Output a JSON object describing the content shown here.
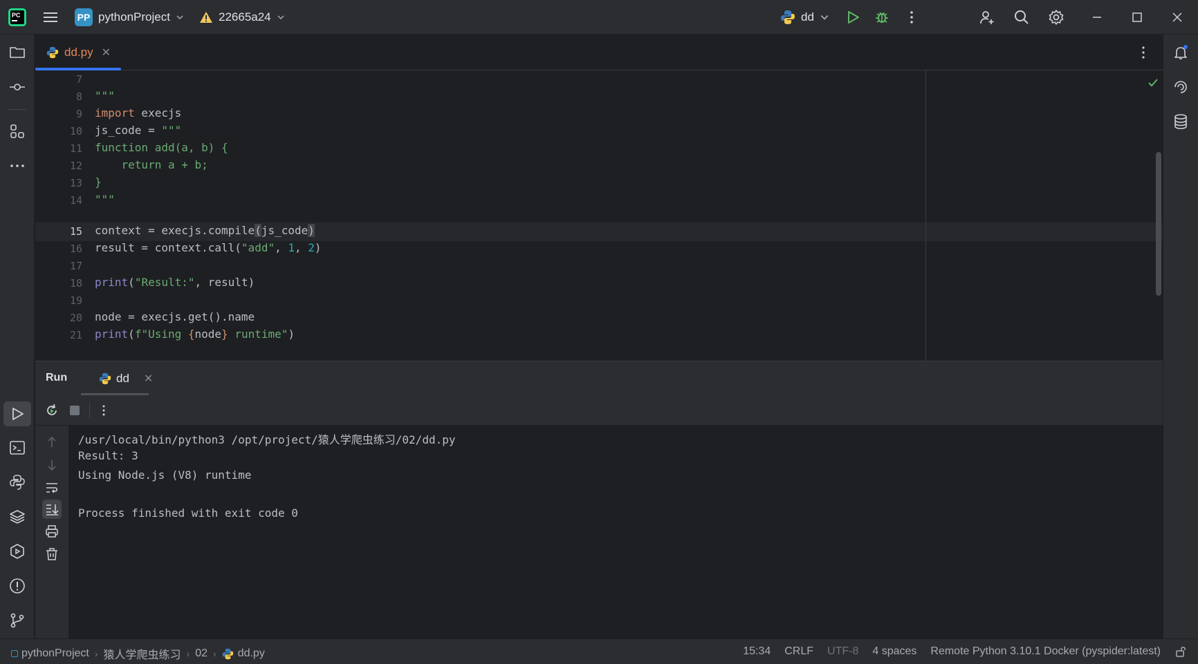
{
  "titlebar": {
    "project_badge": "PP",
    "project_name": "pythonProject",
    "vcs_branch": "22665a24",
    "run_config": "dd"
  },
  "editor": {
    "tab_label": "dd.py",
    "lines": [
      {
        "num": "7"
      },
      {
        "num": "8"
      },
      {
        "num": "9"
      },
      {
        "num": "10"
      },
      {
        "num": "11"
      },
      {
        "num": "12"
      },
      {
        "num": "13"
      },
      {
        "num": "14"
      },
      {
        "num": "15"
      },
      {
        "num": "16"
      },
      {
        "num": "17"
      },
      {
        "num": "18"
      },
      {
        "num": "19"
      },
      {
        "num": "20"
      },
      {
        "num": "21"
      }
    ],
    "code": {
      "l8": "\"\"\"",
      "l9_kw": "import",
      "l9_rest": " execjs",
      "l10_a": "js_code = ",
      "l10_b": "\"\"\"",
      "l11": "function add(a, b) {",
      "l12": "    return a + b;",
      "l13": "}",
      "l14": "\"\"\"",
      "l15_a": "context = execjs.compile",
      "l15_b": "(",
      "l15_c": "js_code",
      "l15_d": ")",
      "l16_a": "result = context.call(",
      "l16_b": "\"add\"",
      "l16_c": ", ",
      "l16_d": "1",
      "l16_e": ", ",
      "l16_f": "2",
      "l16_g": ")",
      "l18_a": "print",
      "l18_b": "(",
      "l18_c": "\"Result:\"",
      "l18_d": ", result)",
      "l20": "node = execjs.get().name",
      "l21_a": "print",
      "l21_b": "(",
      "l21_c": "f\"Using ",
      "l21_d": "{",
      "l21_e": "node",
      "l21_f": "}",
      "l21_g": " runtime\"",
      "l21_h": ")"
    }
  },
  "run": {
    "title": "Run",
    "tab_label": "dd",
    "console": [
      "/usr/local/bin/python3 /opt/project/猿人学爬虫练习/02/dd.py",
      "Result: 3",
      "Using Node.js (V8) runtime",
      "",
      "Process finished with exit code 0"
    ]
  },
  "statusbar": {
    "crumbs": [
      "pythonProject",
      "猿人学爬虫练习",
      "02",
      "dd.py"
    ],
    "position": "15:34",
    "line_sep": "CRLF",
    "encoding": "UTF-8",
    "indent": "4 spaces",
    "interpreter": "Remote Python 3.10.1 Docker (pyspider:latest)"
  },
  "colors": {
    "accent": "#3574f0",
    "keyword": "#cf8e6d",
    "string": "#6aab73",
    "number": "#2aacb8",
    "builtin": "#8888c6",
    "run_green": "#5fb865"
  }
}
